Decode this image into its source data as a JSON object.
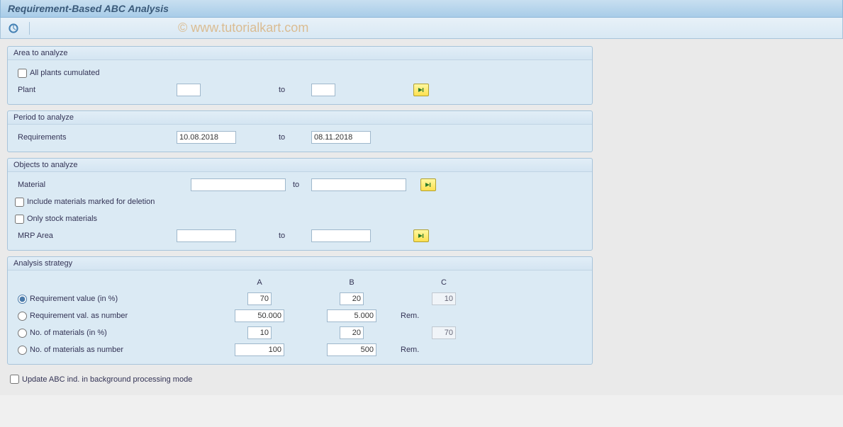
{
  "title": "Requirement-Based ABC Analysis",
  "watermark": "© www.tutorialkart.com",
  "groups": {
    "area": {
      "title": "Area to analyze",
      "allPlantsLabel": "All plants cumulated",
      "plantLabel": "Plant",
      "to": "to",
      "plantFrom": "",
      "plantTo": ""
    },
    "period": {
      "title": "Period to analyze",
      "reqLabel": "Requirements",
      "to": "to",
      "from": "10.08.2018",
      "toDate": "08.11.2018"
    },
    "objects": {
      "title": "Objects to analyze",
      "materialLabel": "Material",
      "to": "to",
      "materialFrom": "",
      "materialTo": "",
      "includeDel": "Include materials marked for deletion",
      "onlyStock": "Only stock materials",
      "mrpArea": "MRP Area",
      "mrpFrom": "",
      "mrpTo": ""
    },
    "strategy": {
      "title": "Analysis strategy",
      "colA": "A",
      "colB": "B",
      "colC": "C",
      "reqValPct": "Requirement value (in %)",
      "reqValNum": "Requirement val. as number",
      "noMatPct": "No. of materials (in %)",
      "noMatNum": "No. of materials as number",
      "row1": {
        "a": "70",
        "b": "20",
        "c": "10"
      },
      "row2": {
        "a": "50.000",
        "b": "5.000",
        "c": "Rem."
      },
      "row3": {
        "a": "10",
        "b": "20",
        "c": "70"
      },
      "row4": {
        "a": "100",
        "b": "500",
        "c": "Rem."
      }
    }
  },
  "bottomCheck": "Update ABC ind. in background processing mode"
}
